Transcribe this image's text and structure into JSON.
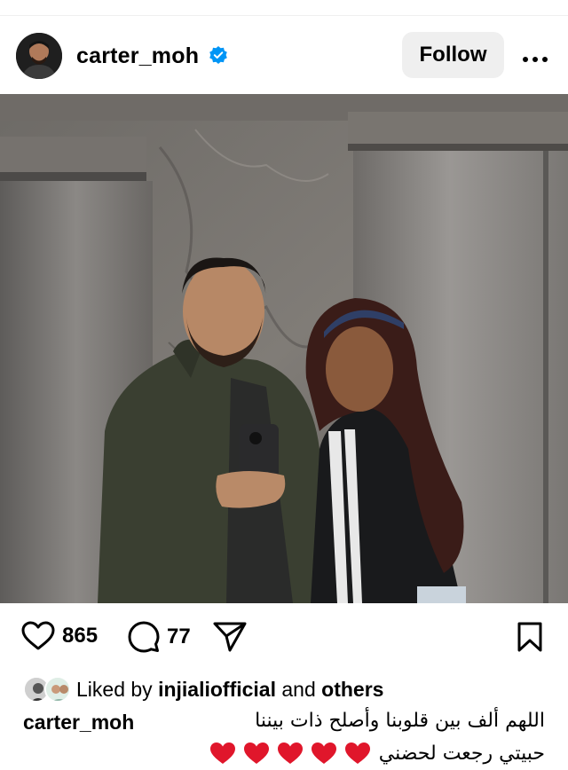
{
  "post": {
    "username": "carter_moh",
    "verified_icon": "verified-badge-icon",
    "follow_label": "Follow",
    "more_icon": "more-options-icon"
  },
  "photo": {
    "alt": "Mirror selfie of a couple in an elevator lobby"
  },
  "actions": {
    "like_icon": "heart-outline-icon",
    "like_count": "865",
    "comment_icon": "comment-icon",
    "comment_count": "77",
    "share_icon": "send-icon",
    "save_icon": "bookmark-icon"
  },
  "likes": {
    "prefix": "Liked by ",
    "user": "injialiofficial",
    "and": " and ",
    "others": "others"
  },
  "caption": {
    "user": "carter_moh",
    "line1": "اللهم ألف بين قلوبنا وأصلح ذات بيننا",
    "line2": "حبيتي رجعت لحضني",
    "heart_count": 5
  },
  "colors": {
    "verified": "#0095f6",
    "heart": "#e0162b",
    "follow_bg": "#efefef"
  }
}
